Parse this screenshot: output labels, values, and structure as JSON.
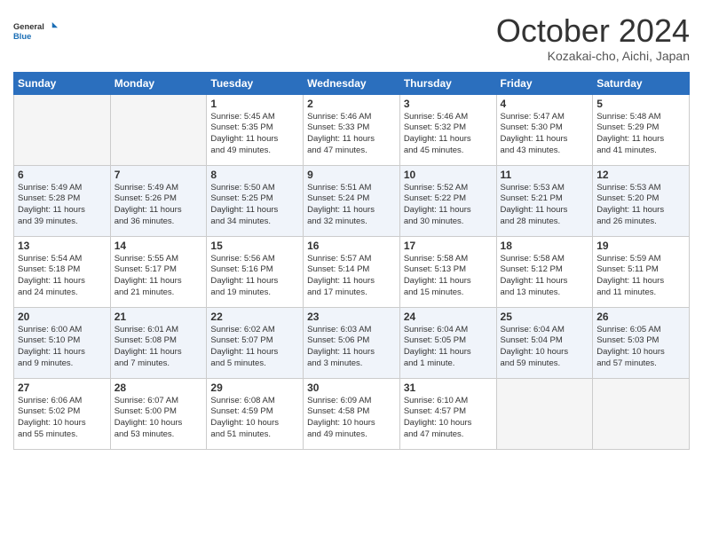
{
  "header": {
    "logo_general": "General",
    "logo_blue": "Blue",
    "month_title": "October 2024",
    "subtitle": "Kozakai-cho, Aichi, Japan"
  },
  "weekdays": [
    "Sunday",
    "Monday",
    "Tuesday",
    "Wednesday",
    "Thursday",
    "Friday",
    "Saturday"
  ],
  "weeks": [
    [
      {
        "day": "",
        "info": ""
      },
      {
        "day": "",
        "info": ""
      },
      {
        "day": "1",
        "info": "Sunrise: 5:45 AM\nSunset: 5:35 PM\nDaylight: 11 hours\nand 49 minutes."
      },
      {
        "day": "2",
        "info": "Sunrise: 5:46 AM\nSunset: 5:33 PM\nDaylight: 11 hours\nand 47 minutes."
      },
      {
        "day": "3",
        "info": "Sunrise: 5:46 AM\nSunset: 5:32 PM\nDaylight: 11 hours\nand 45 minutes."
      },
      {
        "day": "4",
        "info": "Sunrise: 5:47 AM\nSunset: 5:30 PM\nDaylight: 11 hours\nand 43 minutes."
      },
      {
        "day": "5",
        "info": "Sunrise: 5:48 AM\nSunset: 5:29 PM\nDaylight: 11 hours\nand 41 minutes."
      }
    ],
    [
      {
        "day": "6",
        "info": "Sunrise: 5:49 AM\nSunset: 5:28 PM\nDaylight: 11 hours\nand 39 minutes."
      },
      {
        "day": "7",
        "info": "Sunrise: 5:49 AM\nSunset: 5:26 PM\nDaylight: 11 hours\nand 36 minutes."
      },
      {
        "day": "8",
        "info": "Sunrise: 5:50 AM\nSunset: 5:25 PM\nDaylight: 11 hours\nand 34 minutes."
      },
      {
        "day": "9",
        "info": "Sunrise: 5:51 AM\nSunset: 5:24 PM\nDaylight: 11 hours\nand 32 minutes."
      },
      {
        "day": "10",
        "info": "Sunrise: 5:52 AM\nSunset: 5:22 PM\nDaylight: 11 hours\nand 30 minutes."
      },
      {
        "day": "11",
        "info": "Sunrise: 5:53 AM\nSunset: 5:21 PM\nDaylight: 11 hours\nand 28 minutes."
      },
      {
        "day": "12",
        "info": "Sunrise: 5:53 AM\nSunset: 5:20 PM\nDaylight: 11 hours\nand 26 minutes."
      }
    ],
    [
      {
        "day": "13",
        "info": "Sunrise: 5:54 AM\nSunset: 5:18 PM\nDaylight: 11 hours\nand 24 minutes."
      },
      {
        "day": "14",
        "info": "Sunrise: 5:55 AM\nSunset: 5:17 PM\nDaylight: 11 hours\nand 21 minutes."
      },
      {
        "day": "15",
        "info": "Sunrise: 5:56 AM\nSunset: 5:16 PM\nDaylight: 11 hours\nand 19 minutes."
      },
      {
        "day": "16",
        "info": "Sunrise: 5:57 AM\nSunset: 5:14 PM\nDaylight: 11 hours\nand 17 minutes."
      },
      {
        "day": "17",
        "info": "Sunrise: 5:58 AM\nSunset: 5:13 PM\nDaylight: 11 hours\nand 15 minutes."
      },
      {
        "day": "18",
        "info": "Sunrise: 5:58 AM\nSunset: 5:12 PM\nDaylight: 11 hours\nand 13 minutes."
      },
      {
        "day": "19",
        "info": "Sunrise: 5:59 AM\nSunset: 5:11 PM\nDaylight: 11 hours\nand 11 minutes."
      }
    ],
    [
      {
        "day": "20",
        "info": "Sunrise: 6:00 AM\nSunset: 5:10 PM\nDaylight: 11 hours\nand 9 minutes."
      },
      {
        "day": "21",
        "info": "Sunrise: 6:01 AM\nSunset: 5:08 PM\nDaylight: 11 hours\nand 7 minutes."
      },
      {
        "day": "22",
        "info": "Sunrise: 6:02 AM\nSunset: 5:07 PM\nDaylight: 11 hours\nand 5 minutes."
      },
      {
        "day": "23",
        "info": "Sunrise: 6:03 AM\nSunset: 5:06 PM\nDaylight: 11 hours\nand 3 minutes."
      },
      {
        "day": "24",
        "info": "Sunrise: 6:04 AM\nSunset: 5:05 PM\nDaylight: 11 hours\nand 1 minute."
      },
      {
        "day": "25",
        "info": "Sunrise: 6:04 AM\nSunset: 5:04 PM\nDaylight: 10 hours\nand 59 minutes."
      },
      {
        "day": "26",
        "info": "Sunrise: 6:05 AM\nSunset: 5:03 PM\nDaylight: 10 hours\nand 57 minutes."
      }
    ],
    [
      {
        "day": "27",
        "info": "Sunrise: 6:06 AM\nSunset: 5:02 PM\nDaylight: 10 hours\nand 55 minutes."
      },
      {
        "day": "28",
        "info": "Sunrise: 6:07 AM\nSunset: 5:00 PM\nDaylight: 10 hours\nand 53 minutes."
      },
      {
        "day": "29",
        "info": "Sunrise: 6:08 AM\nSunset: 4:59 PM\nDaylight: 10 hours\nand 51 minutes."
      },
      {
        "day": "30",
        "info": "Sunrise: 6:09 AM\nSunset: 4:58 PM\nDaylight: 10 hours\nand 49 minutes."
      },
      {
        "day": "31",
        "info": "Sunrise: 6:10 AM\nSunset: 4:57 PM\nDaylight: 10 hours\nand 47 minutes."
      },
      {
        "day": "",
        "info": ""
      },
      {
        "day": "",
        "info": ""
      }
    ]
  ]
}
